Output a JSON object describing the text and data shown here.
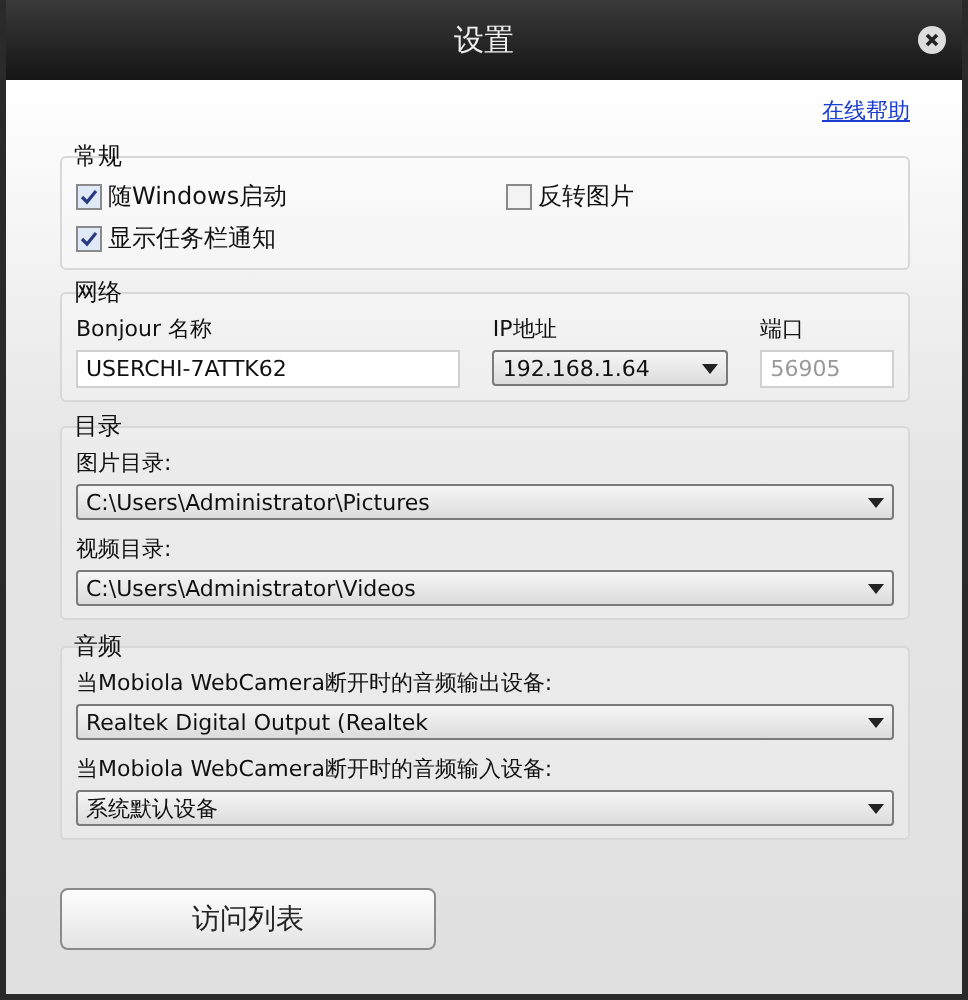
{
  "window": {
    "title": "设置"
  },
  "help_link": "在线帮助",
  "general": {
    "label": "常规",
    "checkboxes": [
      {
        "label": "随Windows启动",
        "checked": true
      },
      {
        "label": "反转图片",
        "checked": false
      },
      {
        "label": "显示任务栏通知",
        "checked": true
      }
    ]
  },
  "network": {
    "label": "网络",
    "bonjour_label": "Bonjour 名称",
    "bonjour_value": "USERCHI-7ATTK62",
    "ip_label": "IP地址",
    "ip_value": "192.168.1.64",
    "port_label": "端口",
    "port_value": "56905",
    "port_disabled": true
  },
  "directories": {
    "label": "目录",
    "fields": [
      {
        "label": "图片目录:",
        "value": "C:\\Users\\Administrator\\Pictures"
      },
      {
        "label": "视频目录:",
        "value": "C:\\Users\\Administrator\\Videos"
      }
    ]
  },
  "audio": {
    "label": "音频",
    "fields": [
      {
        "label": "当Mobiola WebCamera断开时的音频输出设备:",
        "value": "Realtek Digital Output (Realtek"
      },
      {
        "label": "当Mobiola WebCamera断开时的音频输入设备:",
        "value": "系统默认设备"
      }
    ]
  },
  "button": "访问列表"
}
